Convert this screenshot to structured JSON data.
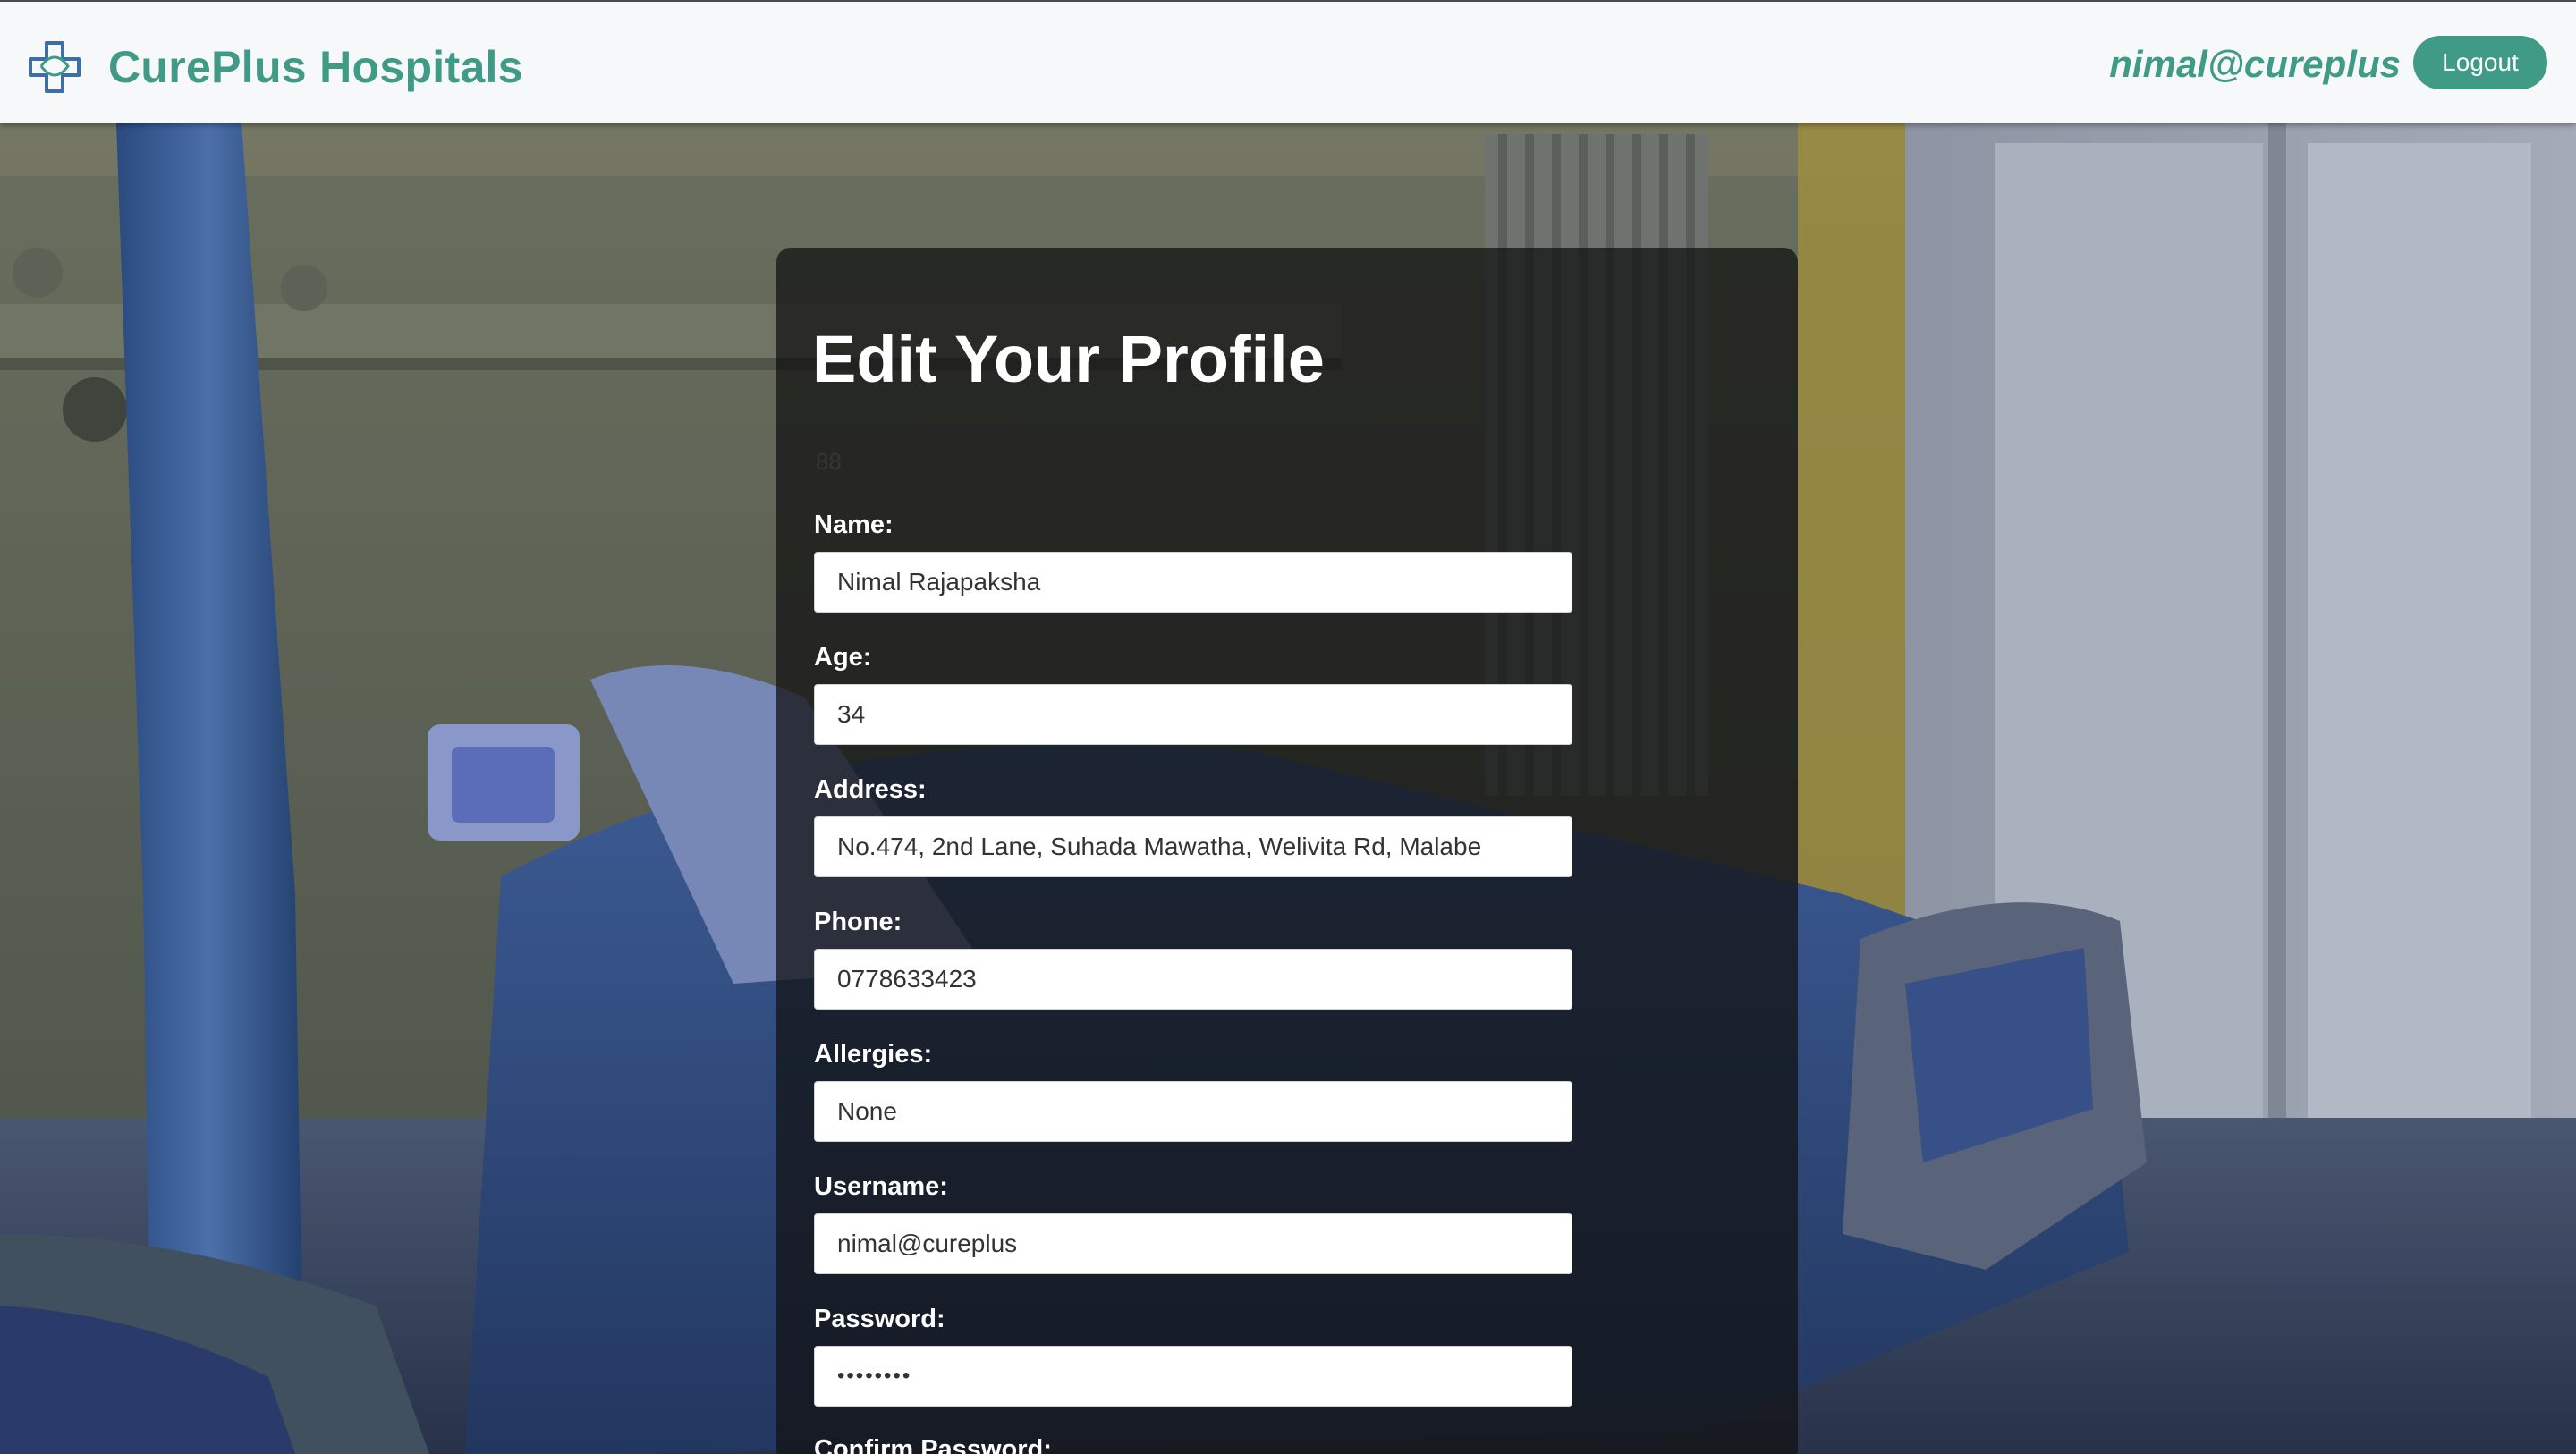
{
  "navbar": {
    "brand_name": "CurePlus Hospitals",
    "brand_icon": "medical-cross-icon",
    "user_email": "nimal@cureplus",
    "logout_label": "Logout"
  },
  "profile": {
    "title": "Edit Your Profile",
    "user_id": "88",
    "fields": {
      "name": {
        "label": "Name:",
        "value": "Nimal Rajapaksha"
      },
      "age": {
        "label": "Age:",
        "value": "34"
      },
      "address": {
        "label": "Address:",
        "value": "No.474, 2nd Lane, Suhada Mawatha, Welivita Rd, Malabe"
      },
      "phone": {
        "label": "Phone:",
        "value": "0778633423"
      },
      "allergies": {
        "label": "Allergies:",
        "value": "None"
      },
      "username": {
        "label": "Username:",
        "value": "nimal@cureplus"
      },
      "password": {
        "label": "Password:",
        "value": "••••••••"
      },
      "confirm_password": {
        "label": "Confirm Password:"
      }
    }
  },
  "colors": {
    "brand": "#3f9b85",
    "navbar_bg": "#f7f8fa",
    "panel_bg": "rgba(18,18,18,0.74)"
  }
}
